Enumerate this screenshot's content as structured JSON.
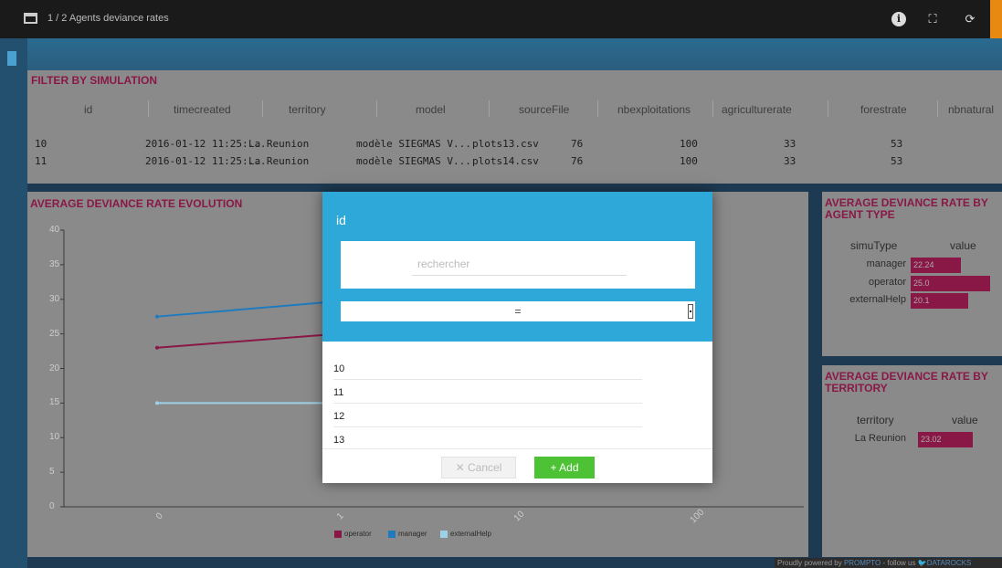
{
  "topbar": {
    "title": "1 / 2 Agents deviance rates",
    "info_icon": "info-icon",
    "fullscreen_icon": "fullscreen-icon",
    "refresh_icon": "refresh-icon"
  },
  "filter": {
    "title": "FILTER BY SIMULATION",
    "columns": [
      "id",
      "timecreated",
      "territory",
      "model",
      "sourceFile",
      "nbexploitations",
      "agriculturerate",
      "forestrate",
      "nbnatural"
    ],
    "rows": [
      {
        "id": "10",
        "timecreated": "2016-01-12 11:25:...",
        "territory": "La Reunion",
        "model": "modèle SIEGMAS V...",
        "sourceFile": "plots13.csv",
        "nbexploitations": "76",
        "agriculturerate": "100",
        "forestrate": "33",
        "nbnatural": "53"
      },
      {
        "id": "11",
        "timecreated": "2016-01-12 11:25:...",
        "territory": "La Reunion",
        "model": "modèle SIEGMAS V...",
        "sourceFile": "plots14.csv",
        "nbexploitations": "76",
        "agriculturerate": "100",
        "forestrate": "33",
        "nbnatural": "53"
      }
    ]
  },
  "evolution": {
    "title": "AVERAGE DEVIANCE RATE EVOLUTION",
    "legend": [
      "operator",
      "manager",
      "externalHelp"
    ]
  },
  "chart_data": {
    "type": "line",
    "title": "AVERAGE DEVIANCE RATE EVOLUTION",
    "yticks": [
      "40",
      "35",
      "30",
      "25",
      "20",
      "15",
      "10",
      "5",
      "0"
    ],
    "xticks": [
      "0",
      "1",
      "10",
      "100"
    ],
    "ylim": [
      0,
      40
    ],
    "series": [
      {
        "name": "operator",
        "color": "#8a1846",
        "points": [
          [
            0,
            23
          ],
          [
            1,
            25
          ]
        ]
      },
      {
        "name": "manager",
        "color": "#1e7bc0",
        "points": [
          [
            0,
            27.5
          ],
          [
            1,
            29.7
          ]
        ]
      },
      {
        "name": "externalHelp",
        "color": "#9fd1e6",
        "points": [
          [
            0,
            15
          ],
          [
            1,
            15
          ]
        ]
      }
    ],
    "legend_position": "bottom"
  },
  "agent_type": {
    "title": "AVERAGE DEVIANCE RATE BY AGENT TYPE",
    "col1": "simuType",
    "col2": "value",
    "rows": [
      {
        "label": "manager",
        "value": "22.24"
      },
      {
        "label": "operator",
        "value": "25.0"
      },
      {
        "label": "externalHelp",
        "value": "20.1"
      }
    ]
  },
  "territory": {
    "title": "AVERAGE DEVIANCE RATE BY TERRITORY",
    "col1": "territory",
    "col2": "value",
    "rows": [
      {
        "label": "La Reunion",
        "value": "23.02"
      }
    ]
  },
  "footer": {
    "prefix": "Proudly powered by ",
    "brand": "PROMPTO",
    "middle": " - follow us ",
    "handle": "DATAROCKS"
  },
  "modal": {
    "title": "id",
    "search_placeholder": "rechercher",
    "operator": "=",
    "items": [
      "10",
      "11",
      "12",
      "13"
    ],
    "cancel_label": "✕ Cancel",
    "add_label": "+ Add"
  },
  "colors": {
    "accent": "#2ea8d8",
    "brand": "#8a1846",
    "add": "#4cc234",
    "topbar_accent": "#e88a12"
  }
}
